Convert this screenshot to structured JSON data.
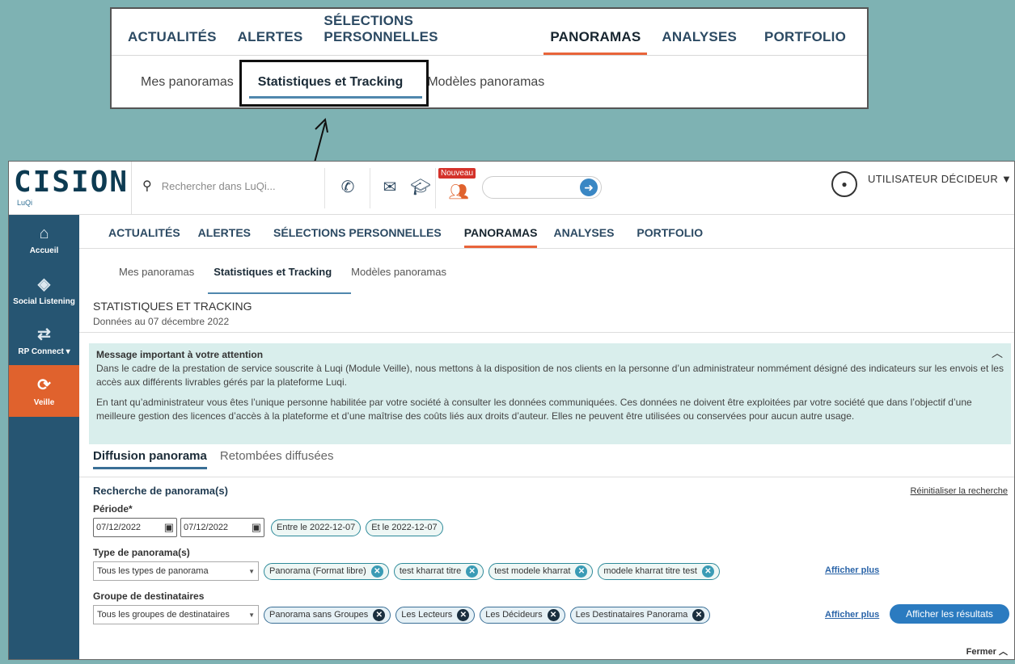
{
  "zoom": {
    "tabs": [
      "ACTUALITÉS",
      "ALERTES",
      "SÉLECTIONS PERSONNELLES",
      "PANORAMAS",
      "ANALYSES",
      "PORTFOLIO"
    ],
    "subtabs": [
      "Mes panoramas",
      "Statistiques et Tracking",
      "Modèles panoramas"
    ]
  },
  "logo": {
    "text": "CISION",
    "sub": "LuQi"
  },
  "search": {
    "placeholder": "Rechercher dans LuQi..."
  },
  "badge_new": "Nouveau",
  "user": {
    "name": "UTILISATEUR DÉCIDEUR ▼"
  },
  "sidebar": {
    "items": [
      {
        "label": "Accueil",
        "icon": "home-icon"
      },
      {
        "label": "Social Listening",
        "icon": "social-listening-icon"
      },
      {
        "label": "RP Connect ▾",
        "icon": "rp-connect-icon"
      },
      {
        "label": "Veille",
        "icon": "refresh-icon"
      }
    ]
  },
  "nav": {
    "tabs": [
      "ACTUALITÉS",
      "ALERTES",
      "SÉLECTIONS PERSONNELLES",
      "PANORAMAS",
      "ANALYSES",
      "PORTFOLIO"
    ],
    "subtabs": [
      "Mes panoramas",
      "Statistiques et Tracking",
      "Modèles panoramas"
    ]
  },
  "page": {
    "title": "STATISTIQUES ET TRACKING",
    "date": "Données au 07 décembre 2022"
  },
  "notice": {
    "title": "Message important à votre attention",
    "p1": "Dans le cadre de la prestation de service souscrite à Luqi (Module Veille), nous mettons à la disposition de nos clients en la personne d’un administrateur nommément désigné des indicateurs sur les envois et les accès aux différents livrables gérés par la plateforme Luqi.",
    "p2": "En tant qu’administrateur vous êtes l’unique personne habilitée par votre société à consulter les données communiquées. Ces données ne doivent être exploitées par votre société que dans l’objectif d’une meilleure gestion des licences d’accès à la plateforme et d’une maîtrise des coûts liés aux droits d’auteur. Elles ne peuvent être utilisées ou conservées pour aucun autre usage."
  },
  "dtabs": [
    "Diffusion panorama",
    "Retombées diffusées"
  ],
  "form": {
    "title": "Recherche de panorama(s)",
    "reset": "Réinitialiser la recherche",
    "period_label": "Période*",
    "date_from": "07/12/2022",
    "date_to": "07/12/2022",
    "period_chips": [
      "Entre le 2022-12-07",
      "Et le 2022-12-07"
    ],
    "type_label": "Type de panorama(s)",
    "type_select": "Tous les types de panorama",
    "type_chips": [
      "Panorama (Format libre)",
      "test kharrat titre",
      "test modele kharrat",
      "modele kharrat titre test"
    ],
    "group_label": "Groupe de destinataires",
    "group_select": "Tous les groupes de destinataires",
    "group_chips": [
      "Panorama sans Groupes",
      "Les Lecteurs",
      "Les Décideurs",
      "Les Destinataires Panorama"
    ],
    "more": "Afficher plus",
    "submit": "Afficher les résultats",
    "close": "Fermer ︿"
  }
}
